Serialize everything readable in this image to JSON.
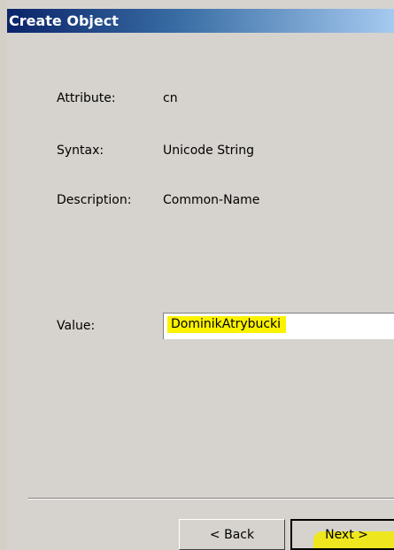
{
  "dialog": {
    "title": "Create Object"
  },
  "fields": {
    "attribute_label": "Attribute:",
    "attribute_value": "cn",
    "syntax_label": "Syntax:",
    "syntax_value": "Unicode String",
    "description_label": "Description:",
    "description_value": "Common-Name",
    "value_label": "Value:",
    "value_input": "DominikAtrybucki"
  },
  "buttons": {
    "back_label": "< Back",
    "next_label": "Next >"
  },
  "colors": {
    "highlight": "#fbf200",
    "dialog_bg": "#d6d3ce",
    "title_bar": "#0a246a"
  }
}
